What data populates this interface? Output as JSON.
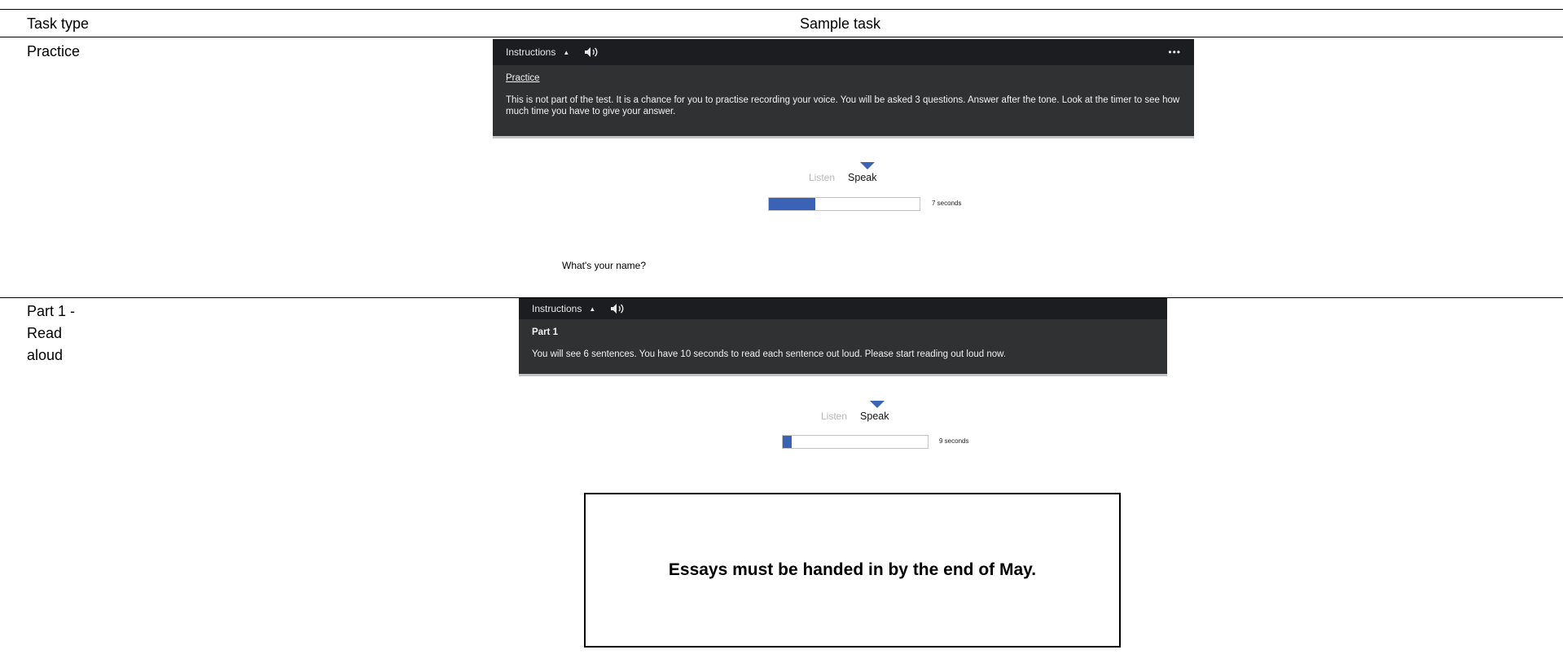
{
  "table": {
    "headers": {
      "task_type": "Task type",
      "sample_task": "Sample task"
    }
  },
  "rows": [
    {
      "task_type": "Practice",
      "instructions_label": "Instructions",
      "more_label": "•••",
      "title": "Practice",
      "text": "This is not part of the test. It is a chance for you to practise recording your voice. You will be asked 3 questions. Answer after the tone. Look at the timer to see how much time you have to give your answer.",
      "listen_label": "Listen",
      "speak_label": "Speak",
      "progress": 0.31,
      "timer": "7 seconds",
      "question": "What's your name?"
    },
    {
      "task_type_lines": [
        "Part 1 -",
        "Read",
        "aloud"
      ],
      "instructions_label": "Instructions",
      "title": "Part 1",
      "text": "You will see 6 sentences. You have 10 seconds to read each sentence out loud. Please start reading out loud now.",
      "listen_label": "Listen",
      "speak_label": "Speak",
      "progress": 0.06,
      "timer": "9 seconds",
      "sentence": "Essays must be handed in by the end of May."
    }
  ],
  "colors": {
    "bar": "#1c1d20",
    "panel": "#2f3133",
    "accent": "#3a62b5"
  },
  "icons": {
    "caret": "caret-up-icon",
    "speaker": "speaker-icon",
    "more": "more-icon",
    "pointer": "triangle-pointer-icon"
  }
}
